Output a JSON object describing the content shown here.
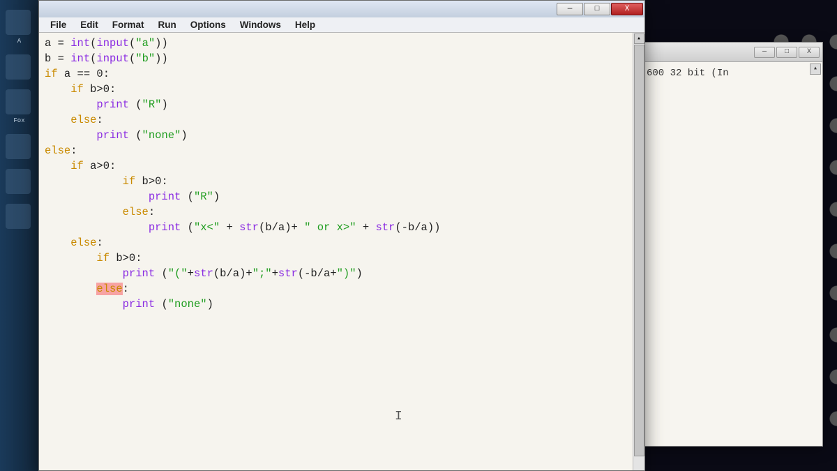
{
  "menus": {
    "file": "File",
    "edit": "Edit",
    "format": "Format",
    "run": "Run",
    "options": "Options",
    "windows": "Windows",
    "help": "Help"
  },
  "window_controls": {
    "minimize": "—",
    "maximize": "□",
    "close": "X"
  },
  "secondary_window": {
    "text_fragment": "600 32 bit (In",
    "scroll_up": "▴"
  },
  "taskbar": {
    "label_a": "A",
    "label_fox": "Fox"
  },
  "code": {
    "l1_a": "a = ",
    "l1_b": "int",
    "l1_c": "(",
    "l1_d": "input",
    "l1_e": "(",
    "l1_f": "\"a\"",
    "l1_g": "))",
    "l2_a": "b = ",
    "l2_b": "int",
    "l2_c": "(",
    "l2_d": "input",
    "l2_e": "(",
    "l2_f": "\"b\"",
    "l2_g": "))",
    "l3_a": "if",
    "l3_b": " a == 0:",
    "l4_a": "    ",
    "l4_b": "if",
    "l4_c": " b>0:",
    "l5_a": "        ",
    "l5_b": "print",
    "l5_c": " (",
    "l5_d": "\"R\"",
    "l5_e": ")",
    "l6_a": "    ",
    "l6_b": "else",
    "l6_c": ":",
    "l7_a": "        ",
    "l7_b": "print",
    "l7_c": " (",
    "l7_d": "\"none\"",
    "l7_e": ")",
    "l8_a": "else",
    "l8_b": ":",
    "l9_a": "    ",
    "l9_b": "if",
    "l9_c": " a>0:",
    "l10_a": "            ",
    "l10_b": "if",
    "l10_c": " b>0:",
    "l11_a": "                ",
    "l11_b": "print",
    "l11_c": " (",
    "l11_d": "\"R\"",
    "l11_e": ")",
    "l12_a": "            ",
    "l12_b": "else",
    "l12_c": ":",
    "l13_a": "                ",
    "l13_b": "print",
    "l13_c": " (",
    "l13_d": "\"x<\"",
    "l13_e": " + ",
    "l13_f": "str",
    "l13_g": "(b/a)+ ",
    "l13_h": "\" or x>\"",
    "l13_i": " + ",
    "l13_j": "str",
    "l13_k": "(-b/a))",
    "l14_a": "    ",
    "l14_b": "else",
    "l14_c": ":",
    "l15_a": "        ",
    "l15_b": "if",
    "l15_c": " b>0:",
    "l16_a": "            ",
    "l16_b": "print",
    "l16_c": " (",
    "l16_d": "\"(\"",
    "l16_e": "+",
    "l16_f": "str",
    "l16_g": "(b/a)+",
    "l16_h": "\";\"",
    "l16_i": "+",
    "l16_j": "str",
    "l16_k": "(-b/a+",
    "l16_l": "\")\"",
    "l16_m": ")",
    "l17_a": "        ",
    "l17_b": "else",
    "l17_c": ":",
    "l18_a": "            ",
    "l18_b": "print",
    "l18_c": " (",
    "l18_d": "\"none\"",
    "l18_e": ")"
  }
}
